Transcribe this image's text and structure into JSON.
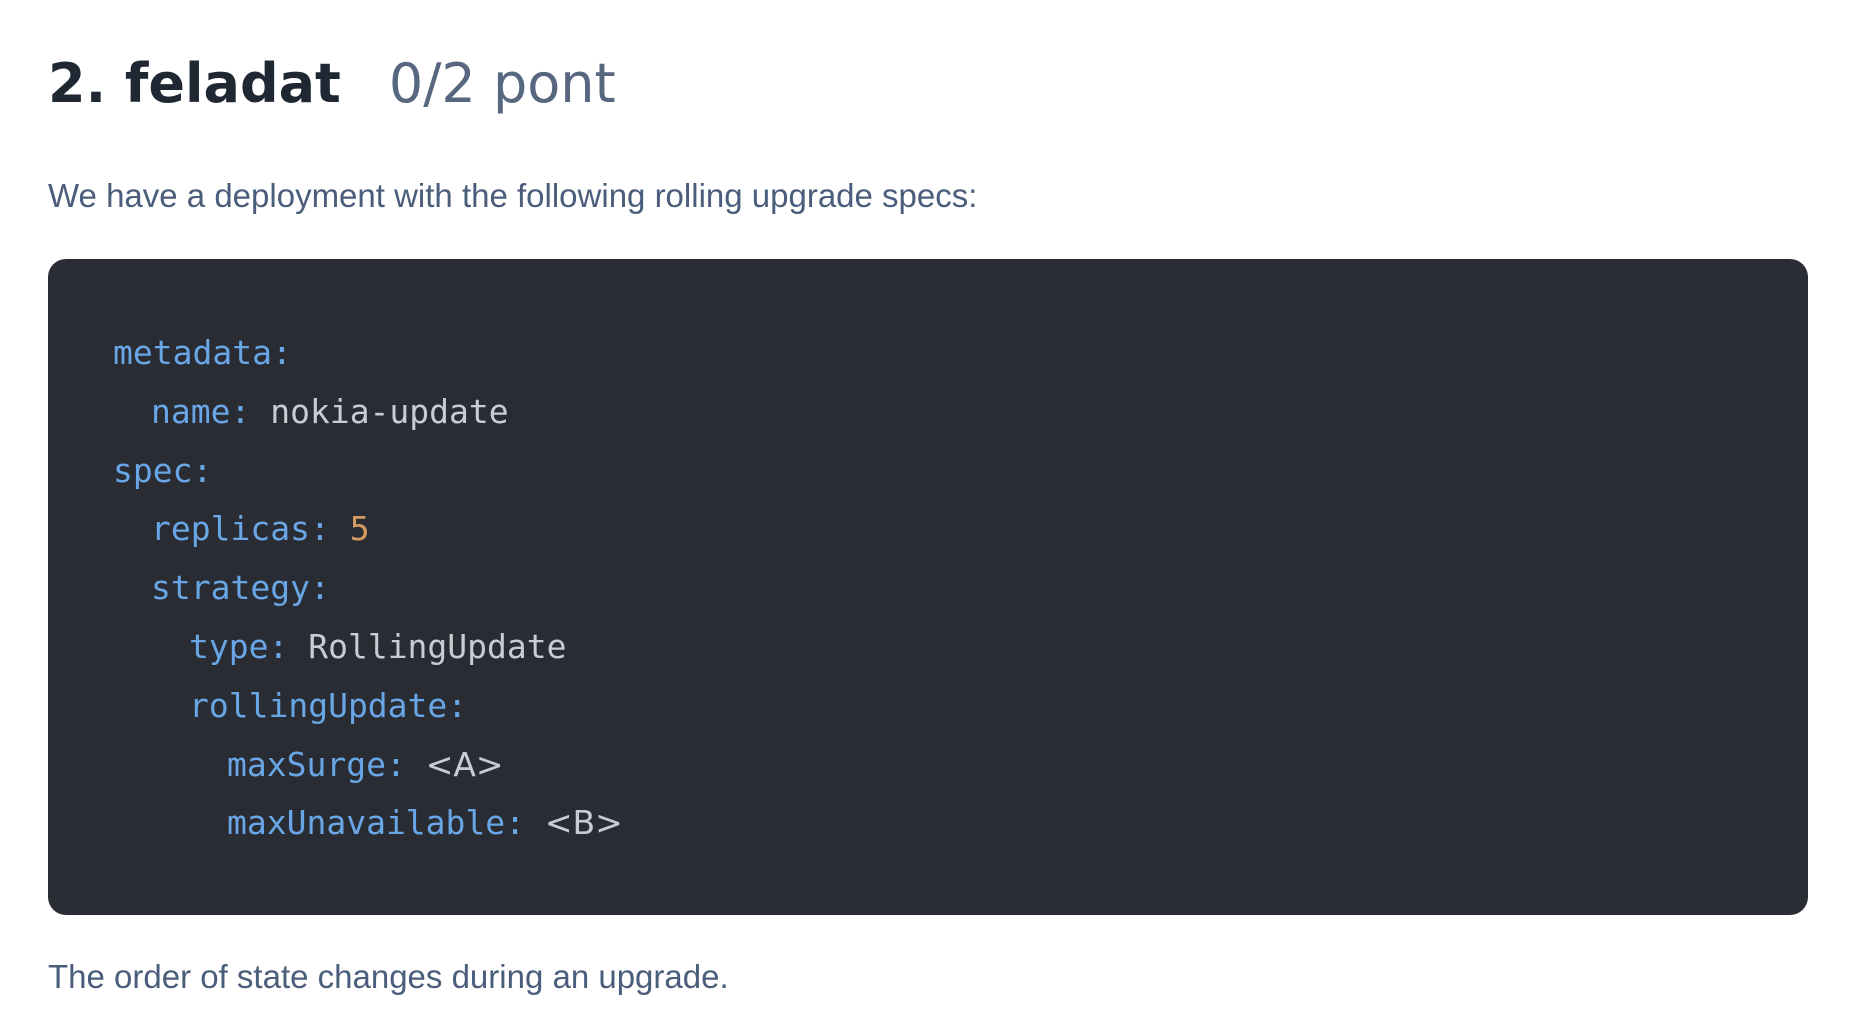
{
  "task": {
    "title": "2. feladat",
    "points": "0/2 pont",
    "intro": "We have a deployment with the following rolling upgrade specs:",
    "footer": "The order of state changes during an upgrade."
  },
  "code": {
    "lines": [
      {
        "key": "metadata:",
        "value": "",
        "level": 0,
        "value_type": "text"
      },
      {
        "key": "name:",
        "value": "nokia-update",
        "level": 1,
        "value_type": "text"
      },
      {
        "key": "spec:",
        "value": "",
        "level": 0,
        "value_type": "text"
      },
      {
        "key": "replicas:",
        "value": "5",
        "level": 1,
        "value_type": "number"
      },
      {
        "key": "strategy:",
        "value": "",
        "level": 1,
        "value_type": "text"
      },
      {
        "key": "type:",
        "value": "RollingUpdate",
        "level": 2,
        "value_type": "text"
      },
      {
        "key": "rollingUpdate:",
        "value": "",
        "level": 2,
        "value_type": "text"
      },
      {
        "key": "maxSurge:",
        "value": "<A>",
        "level": 3,
        "value_type": "placeholder"
      },
      {
        "key": "maxUnavailable:",
        "value": "<B>",
        "level": 3,
        "value_type": "placeholder"
      }
    ]
  },
  "colors": {
    "title": "#1f2733",
    "points": "#56677f",
    "text": "#4a5d7a",
    "code_background": "#2a2c34",
    "yaml_key": "#68a6e6",
    "yaml_value": "#c9ccd2",
    "yaml_number": "#d79b62"
  }
}
